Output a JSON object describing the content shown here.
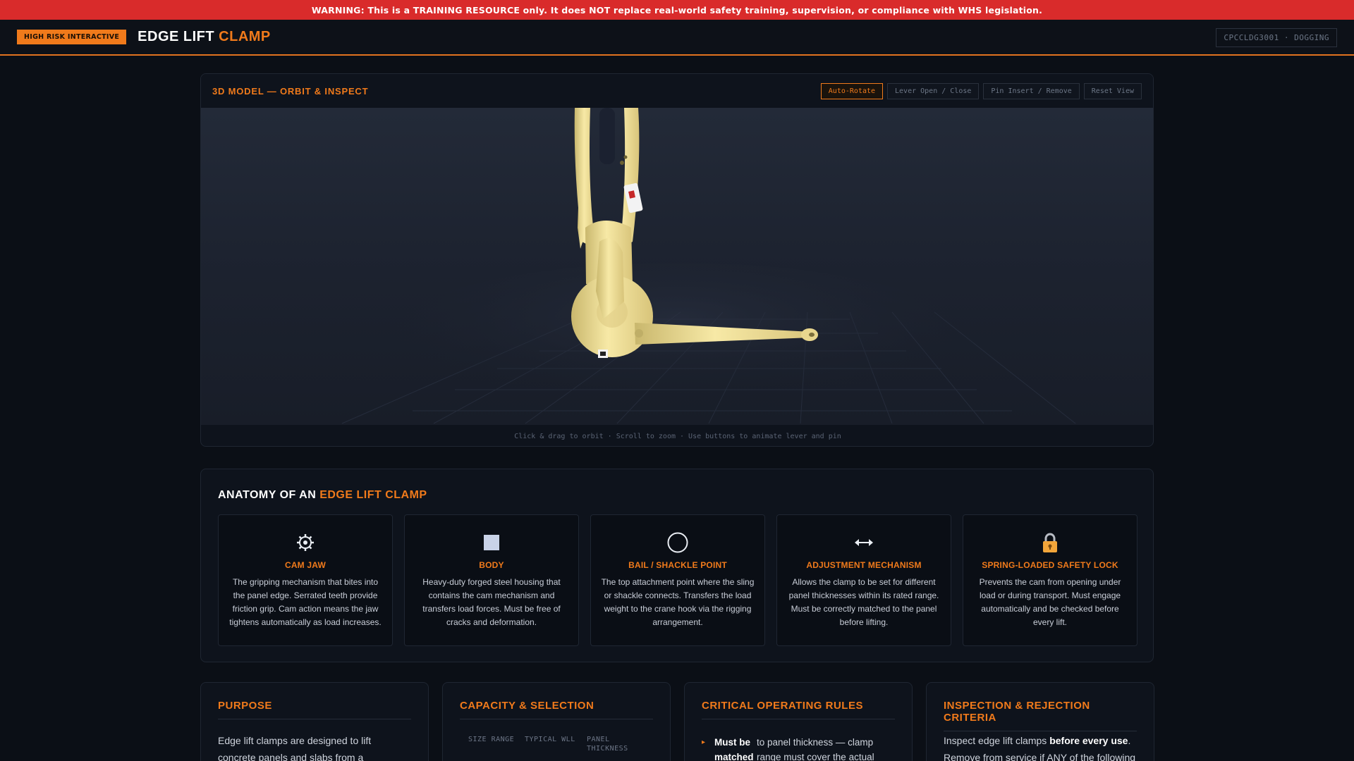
{
  "warning_banner": "WARNING: This is a TRAINING RESOURCE only. It does NOT replace real-world safety training, supervision, or compliance with WHS legislation.",
  "header": {
    "badge": "HIGH RISK INTERACTIVE",
    "title_main": "EDGE LIFT",
    "title_accent": "CLAMP",
    "course_code": "CPCCLDG3001 · DOGGING"
  },
  "viewer": {
    "title": "3D MODEL — ORBIT & INSPECT",
    "controls": [
      {
        "label": "Auto-Rotate",
        "active": true
      },
      {
        "label": "Lever Open / Close",
        "active": false
      },
      {
        "label": "Pin Insert / Remove",
        "active": false
      },
      {
        "label": "Reset View",
        "active": false
      }
    ],
    "hint": "Click & drag to orbit · Scroll to zoom · Use buttons to animate lever and pin"
  },
  "anatomy": {
    "title_main": "ANATOMY OF AN",
    "title_accent": "EDGE LIFT CLAMP",
    "cards": [
      {
        "icon": "gear-icon",
        "title": "CAM JAW",
        "text": "The gripping mechanism that bites into the panel edge. Serrated teeth provide friction grip. Cam action means the jaw tightens automatically as load increases."
      },
      {
        "icon": "square-icon",
        "title": "BODY",
        "text": "Heavy-duty forged steel housing that contains the cam mechanism and transfers load forces. Must be free of cracks and deformation."
      },
      {
        "icon": "circle-icon",
        "title": "BAIL / SHACKLE POINT",
        "text": "The top attachment point where the sling or shackle connects. Transfers the load weight to the crane hook via the rigging arrangement."
      },
      {
        "icon": "double-arrow-icon",
        "title": "ADJUSTMENT MECHANISM",
        "text": "Allows the clamp to be set for different panel thicknesses within its rated range. Must be correctly matched to the panel before lifting."
      },
      {
        "icon": "lock-icon",
        "title": "SPRING-LOADED SAFETY LOCK",
        "text": "Prevents the cam from opening under load or during transport. Must engage automatically and be checked before every lift."
      }
    ]
  },
  "purpose": {
    "title": "PURPOSE",
    "text": "Edge lift clamps are designed to lift concrete panels and slabs from a"
  },
  "capacity": {
    "title": "CAPACITY & SELECTION",
    "columns": [
      "SIZE RANGE",
      "TYPICAL WLL",
      "PANEL THICKNESS"
    ]
  },
  "rules": {
    "title": "CRITICAL OPERATING RULES",
    "items": [
      {
        "strong": "Must be matched",
        "text": "to panel thickness — clamp range must cover the actual"
      }
    ]
  },
  "inspection": {
    "title": "INSPECTION & REJECTION CRITERIA",
    "text_pre": "Inspect edge lift clamps ",
    "text_strong": "before every use",
    "text_post": ". Remove from service if ANY of the following"
  },
  "colors": {
    "accent": "#f07a1b",
    "warning": "#d92b2b",
    "model_yellow": "#f3e39a"
  }
}
